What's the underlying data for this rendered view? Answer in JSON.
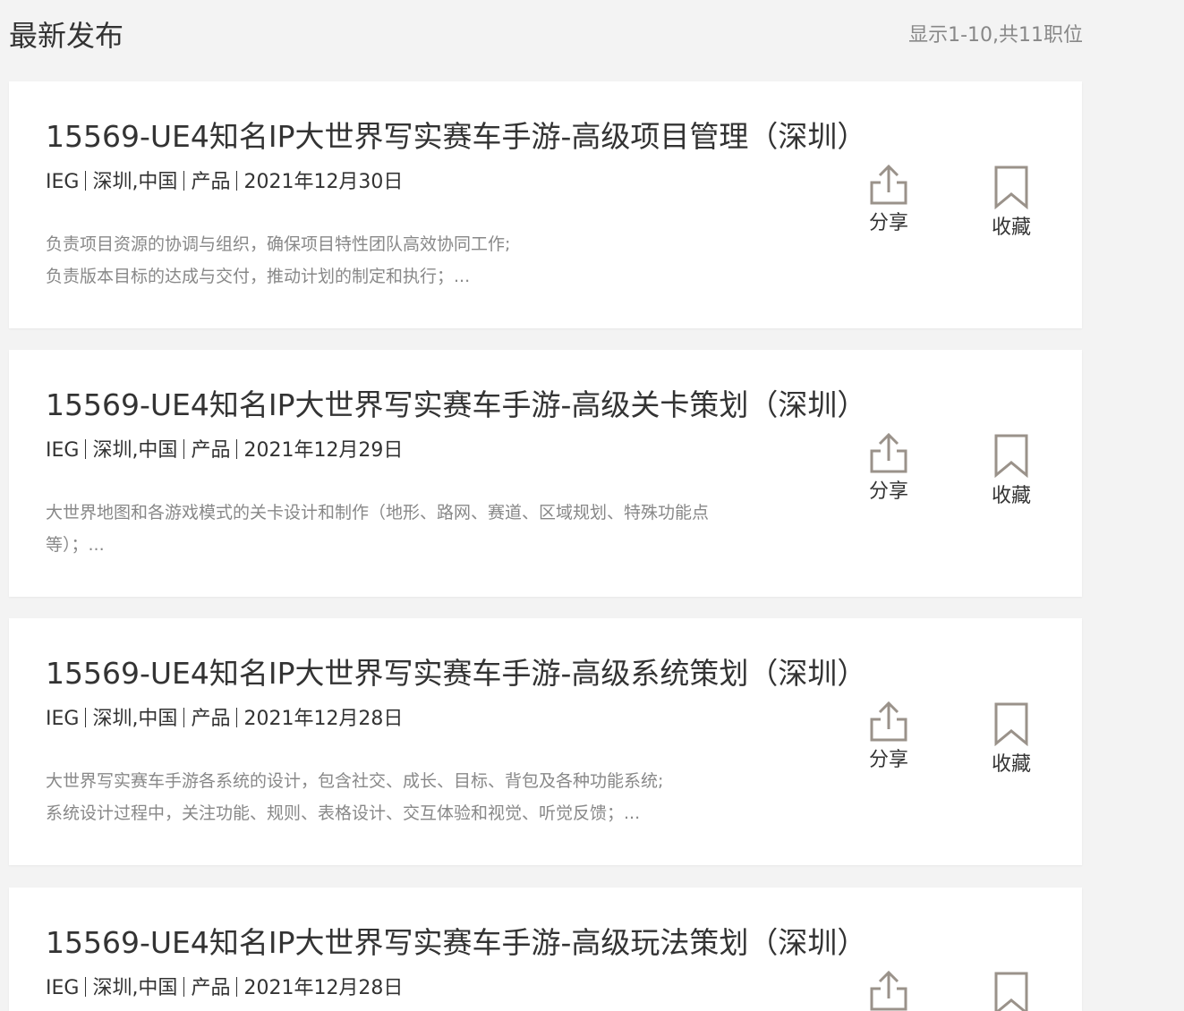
{
  "header": {
    "title": "最新发布",
    "count": "显示1-10,共11职位"
  },
  "actions": {
    "share_label": "分享",
    "fav_label": "收藏"
  },
  "jobs": [
    {
      "title": "15569-UE4知名IP大世界写实赛车手游-高级项目管理（深圳）",
      "dept": "IEG",
      "location": "深圳,中国",
      "category": "产品",
      "date": "2021年12月30日",
      "desc": [
        "负责项目资源的协调与组织，确保项目特性团队高效协同工作;",
        "负责版本目标的达成与交付，推动计划的制定和执行；..."
      ]
    },
    {
      "title": "15569-UE4知名IP大世界写实赛车手游-高级关卡策划（深圳）",
      "dept": "IEG",
      "location": "深圳,中国",
      "category": "产品",
      "date": "2021年12月29日",
      "desc": [
        "大世界地图和各游戏模式的关卡设计和制作（地形、路网、赛道、区域规划、特殊功能点",
        "等）；..."
      ]
    },
    {
      "title": "15569-UE4知名IP大世界写实赛车手游-高级系统策划（深圳）",
      "dept": "IEG",
      "location": "深圳,中国",
      "category": "产品",
      "date": "2021年12月28日",
      "desc": [
        "大世界写实赛车手游各系统的设计，包含社交、成长、目标、背包及各种功能系统;",
        "系统设计过程中，关注功能、规则、表格设计、交互体验和视觉、听觉反馈；..."
      ]
    },
    {
      "title": "15569-UE4知名IP大世界写实赛车手游-高级玩法策划（深圳）",
      "dept": "IEG",
      "location": "深圳,中国",
      "category": "产品",
      "date": "2021年12月28日",
      "desc": []
    }
  ]
}
